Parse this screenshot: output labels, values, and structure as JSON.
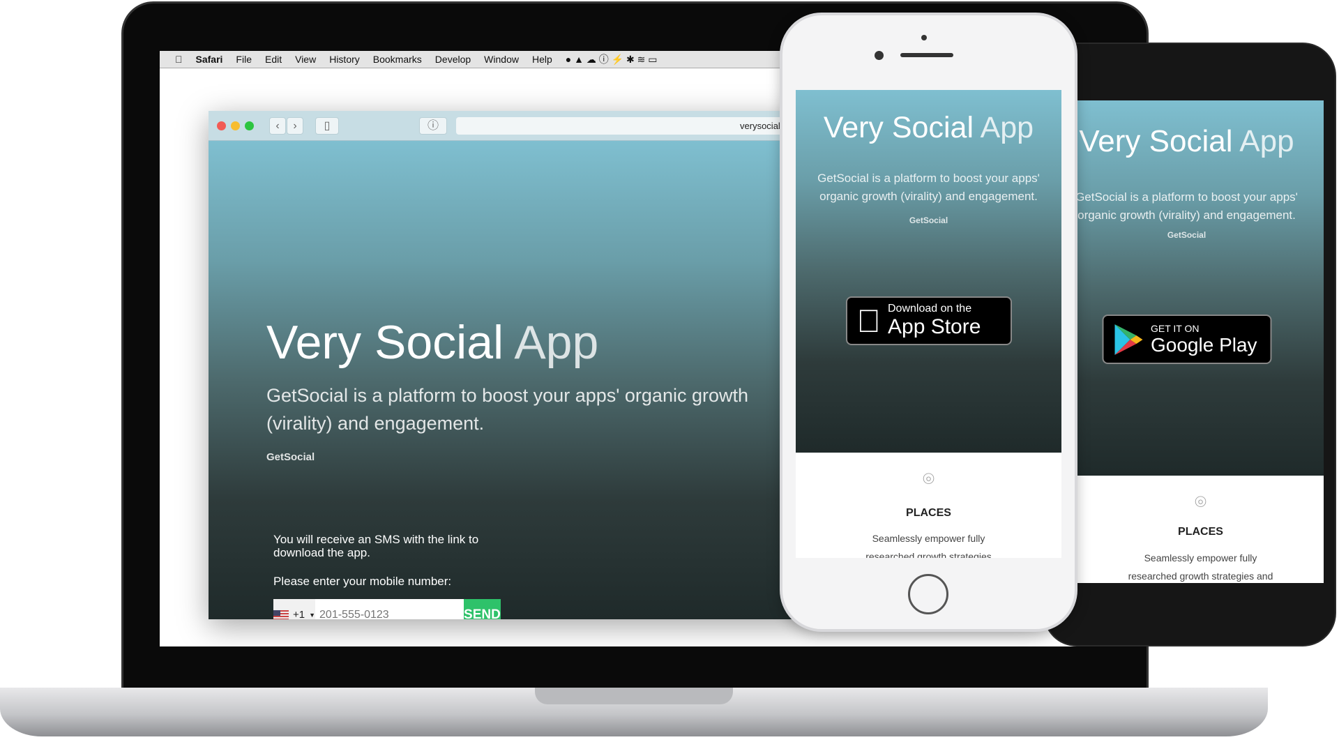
{
  "menubar": {
    "apple": "",
    "items": [
      "Safari",
      "File",
      "Edit",
      "View",
      "History",
      "Bookmarks",
      "Develop",
      "Window",
      "Help"
    ]
  },
  "browser": {
    "url": "verysocial.com",
    "back": "‹",
    "forward": "›"
  },
  "hero": {
    "title_bold": "Very Social",
    "title_thin": "App",
    "subtitle": "GetSocial is a platform to boost your apps' organic growth (virality) and engagement.",
    "brand": "GetSocial"
  },
  "sms_form": {
    "info": "You will receive an SMS with the link to download the app.",
    "prompt": "Please enter your mobile number:",
    "country_code": "+1",
    "placeholder": "201-555-0123",
    "send_label": "SEND"
  },
  "ios": {
    "badge_small": "Download on the",
    "badge_large": "App Store"
  },
  "android": {
    "badge_small": "GET IT ON",
    "badge_large": "Google Play"
  },
  "feature": {
    "title": "PLACES",
    "text": "Seamlessly empower fully researched growth strategies and"
  },
  "colors": {
    "send": "#2ec26a"
  }
}
